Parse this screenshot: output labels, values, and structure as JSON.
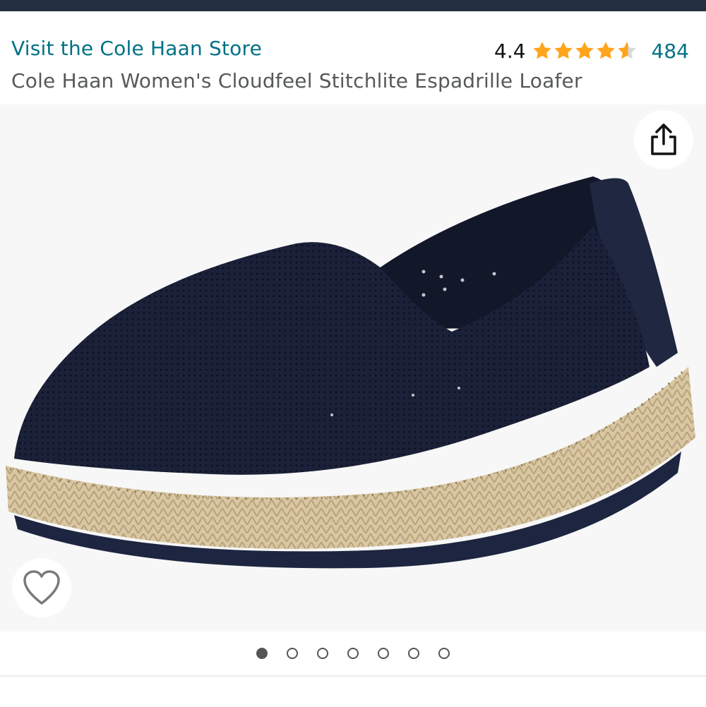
{
  "header": {
    "store_link": "Visit the Cole Haan Store",
    "rating_value": "4.4",
    "rating_stars": 4.4,
    "review_count": "484",
    "product_title": "Cole Haan Women's Cloudfeel Stitchlite Espadrille Loafer"
  },
  "icons": {
    "share": "share-icon",
    "wishlist": "heart-icon",
    "star": "star-icon"
  },
  "gallery": {
    "image_count": 7,
    "active_index": 0
  },
  "colors": {
    "link": "#007185",
    "star": "#ffa41c",
    "topbar": "#232f3e",
    "title": "#565959"
  }
}
